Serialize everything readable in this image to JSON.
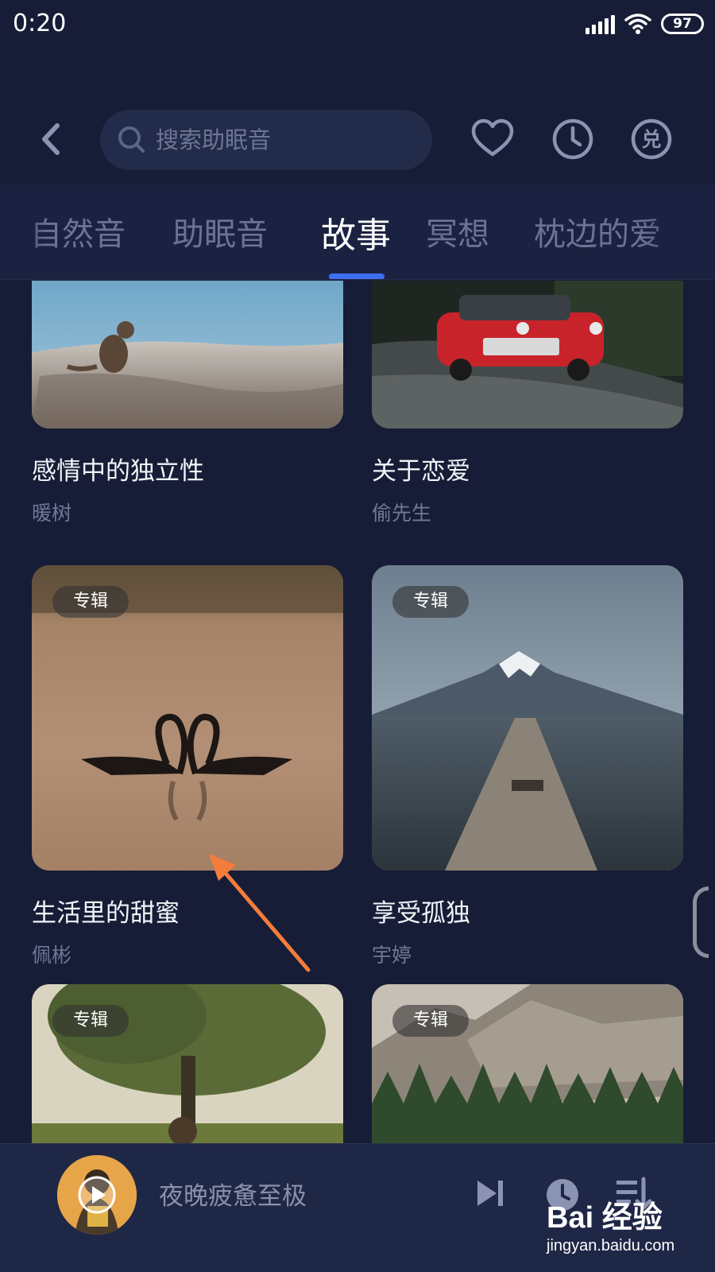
{
  "status_bar": {
    "time": "0:20",
    "battery": "97"
  },
  "header": {
    "search_placeholder": "搜索助眠音"
  },
  "tabs": [
    {
      "label": "自然音"
    },
    {
      "label": "助眠音"
    },
    {
      "label": "故事",
      "active": true
    },
    {
      "label": "冥想"
    },
    {
      "label": "枕边的爱"
    }
  ],
  "cards": [
    {
      "title": "感情中的独立性",
      "author": "暖树"
    },
    {
      "title": "关于恋爱",
      "author": "偷先生"
    },
    {
      "title": "生活里的甜蜜",
      "author": "佩彬",
      "badge": "专辑"
    },
    {
      "title": "享受孤独",
      "author": "宇婷",
      "badge": "专辑"
    },
    {
      "badge": "专辑"
    },
    {
      "badge": "专辑"
    }
  ],
  "player": {
    "track_title": "夜晚疲惫至极"
  },
  "watermark": {
    "logo": "Bai 经验",
    "url": "jingyan.baidu.com"
  },
  "colors": {
    "background": "#171d36",
    "accent": "#3d6ff1",
    "annotation": "#f47c3c"
  }
}
